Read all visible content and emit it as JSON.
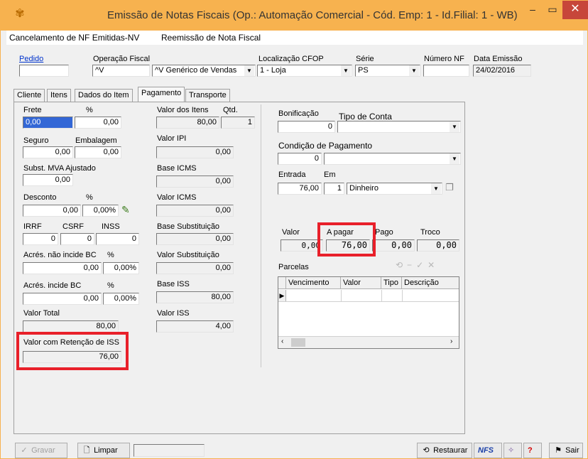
{
  "window": {
    "title": "Emissão de Notas Fiscais (Op.: Automação Comercial - Cód. Emp: 1 - Id.Filial: 1 - WB)"
  },
  "menu": {
    "items": [
      "Cancelamento de NF Emitidas-NV",
      "Reemissão de Nota Fiscal"
    ]
  },
  "header": {
    "pedido_label": "Pedido",
    "pedido_value": "",
    "operacao_label": "Operação Fiscal",
    "operacao_code": "^V",
    "operacao_desc": "^V Genérico de Vendas",
    "localizacao_label": "Localização CFOP",
    "localizacao_value": "1 - Loja",
    "serie_label": "Série",
    "serie_value": "PS",
    "numero_label": "Número NF",
    "numero_value": "",
    "data_label": "Data Emissão",
    "data_value": "24/02/2016"
  },
  "tabs": [
    "Cliente",
    "Itens",
    "Dados do Item",
    "Pagamento",
    "Transporte"
  ],
  "col1": {
    "frete_label": "Frete",
    "pct1": "%",
    "frete_value": "0,00",
    "frete_pct": "0,00",
    "seguro_label": "Seguro",
    "embalagem_label": "Embalagem",
    "seguro_value": "0,00",
    "embalagem_value": "0,00",
    "subst_label": "Subst. MVA Ajustado",
    "subst_value": "0,00",
    "desconto_label": "Desconto",
    "pct2": "%",
    "desconto_value": "0,00",
    "desconto_pct": "0,00%",
    "irrf_label": "IRRF",
    "csrf_label": "CSRF",
    "inss_label": "INSS",
    "irrf_value": "0",
    "csrf_value": "0",
    "inss_value": "0",
    "acres_nao_label": "Acrés. não incide BC",
    "pct3": "%",
    "acres_nao_value": "0,00",
    "acres_nao_pct": "0,00%",
    "acres_inc_label": "Acrés. incide BC",
    "pct4": "%",
    "acres_inc_value": "0,00",
    "acres_inc_pct": "0,00%",
    "total_label": "Valor Total",
    "total_value": "80,00",
    "retencao_label": "Valor com Retenção de ISS",
    "retencao_value": "76,00"
  },
  "col2": {
    "itens_label": "Valor dos Itens",
    "qtd_label": "Qtd.",
    "itens_value": "80,00",
    "qtd_value": "1",
    "ipi_label": "Valor IPI",
    "ipi_value": "0,00",
    "base_icms_label": "Base ICMS",
    "base_icms_value": "0,00",
    "icms_label": "Valor ICMS",
    "icms_value": "0,00",
    "base_sub_label": "Base Substituição",
    "base_sub_value": "0,00",
    "valor_sub_label": "Valor Substituição",
    "valor_sub_value": "0,00",
    "base_iss_label": "Base ISS",
    "base_iss_value": "80,00",
    "valor_iss_label": "Valor ISS",
    "valor_iss_value": "4,00"
  },
  "col3": {
    "bonificacao_label": "Bonificação",
    "bonificacao_value": "0",
    "tipo_conta_label": "Tipo de Conta",
    "tipo_conta_value": "",
    "condicao_label": "Condição de Pagamento",
    "condicao_value": "0",
    "condicao_desc": "",
    "entrada_label": "Entrada",
    "em_label": "Em",
    "entrada_value": "76,00",
    "em_value": "1",
    "forma_value": "Dinheiro",
    "valor_label": "Valor",
    "apagar_label": "A pagar",
    "pago_label": "Pago",
    "troco_label": "Troco",
    "valor_value": "0,00",
    "apagar_value": "76,00",
    "pago_value": "0,00",
    "troco_value": "0,00",
    "parcelas_label": "Parcelas",
    "grid_columns": [
      "Vencimento",
      "Valor",
      "Tipo",
      "Descrição"
    ]
  },
  "bottom": {
    "gravar_label": "Gravar",
    "limpar_label": "Limpar",
    "restaurar_label": "Restaurar",
    "nfse_label": "NFS",
    "help_label": "?",
    "sair_label": "Sair"
  },
  "colors": {
    "title_bar": "#f7b24f",
    "highlight": "#e8202a",
    "close": "#c7463a"
  }
}
